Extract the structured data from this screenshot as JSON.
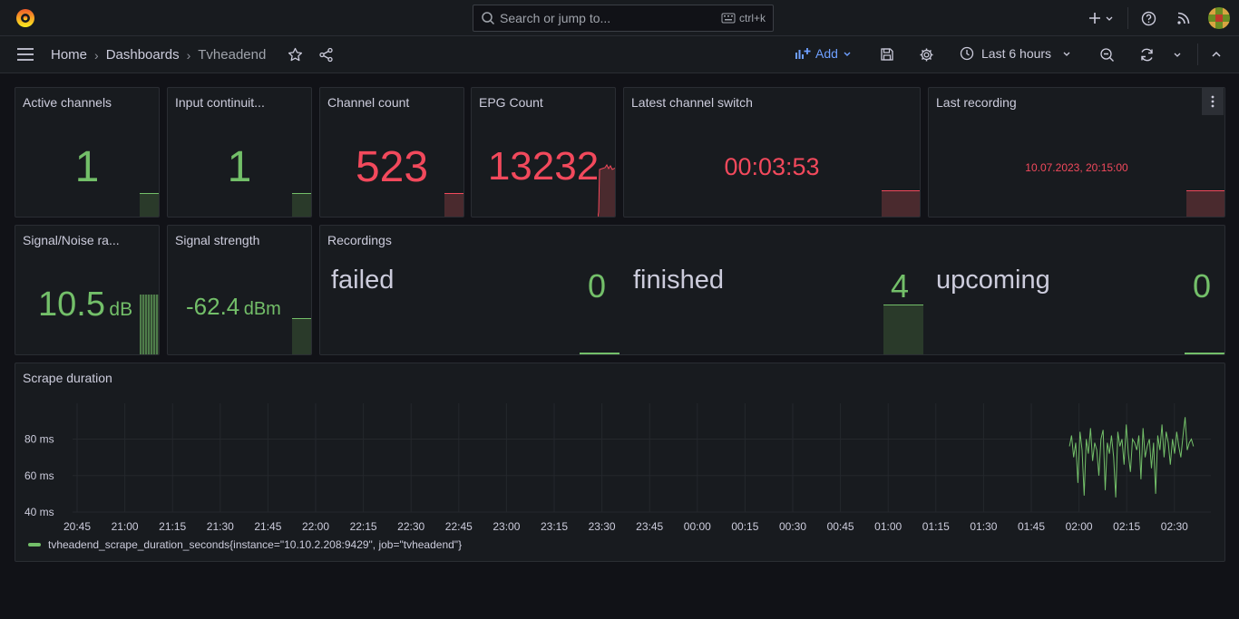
{
  "search": {
    "placeholder": "Search or jump to...",
    "shortcut": "ctrl+k"
  },
  "breadcrumb": {
    "home": "Home",
    "dashboards": "Dashboards",
    "current": "Tvheadend"
  },
  "toolbar": {
    "add_label": "Add",
    "time_range": "Last 6 hours"
  },
  "panels": {
    "active_channels": {
      "title": "Active channels",
      "value": "1"
    },
    "input_continuity": {
      "title": "Input continuit...",
      "value": "1"
    },
    "channel_count": {
      "title": "Channel count",
      "value": "523"
    },
    "epg_count": {
      "title": "EPG Count",
      "value": "13232"
    },
    "latest_switch": {
      "title": "Latest channel switch",
      "value": "00:03:53"
    },
    "last_recording": {
      "title": "Last recording",
      "value": "10.07.2023, 20:15:00"
    },
    "snr": {
      "title": "Signal/Noise ra...",
      "value": "10.5",
      "unit": "dB"
    },
    "signal_strength": {
      "title": "Signal strength",
      "value": "-62.4",
      "unit": "dBm"
    },
    "recordings": {
      "title": "Recordings",
      "items": [
        {
          "label": "failed",
          "value": "0"
        },
        {
          "label": "finished",
          "value": "4"
        },
        {
          "label": "upcoming",
          "value": "0"
        }
      ]
    },
    "scrape": {
      "title": "Scrape duration"
    }
  },
  "colors": {
    "green": "#73bf69",
    "red": "#f2495c",
    "bg": "#111217",
    "panel": "#181b1f"
  },
  "chart_data": {
    "type": "line",
    "title": "Scrape duration",
    "xlabel": "",
    "ylabel": "",
    "x_ticks": [
      "20:45",
      "21:00",
      "21:15",
      "21:30",
      "21:45",
      "22:00",
      "22:15",
      "22:30",
      "22:45",
      "23:00",
      "23:15",
      "23:30",
      "23:45",
      "00:00",
      "00:15",
      "00:30",
      "00:45",
      "01:00",
      "01:15",
      "01:30",
      "01:45",
      "02:00",
      "02:15",
      "02:30"
    ],
    "y_ticks": [
      "40 ms",
      "60 ms",
      "80 ms"
    ],
    "ylim": [
      40,
      95
    ],
    "grid": true,
    "legend_position": "bottom-left",
    "series": [
      {
        "name": "tvheadend_scrape_duration_seconds{instance=\"10.10.2.208:9429\", job=\"tvheadend\"}",
        "x_start": "01:57",
        "x_end": "02:36",
        "values": [
          76,
          82,
          70,
          78,
          56,
          84,
          74,
          49,
          80,
          72,
          86,
          68,
          78,
          74,
          60,
          80,
          85,
          52,
          78,
          72,
          82,
          70,
          48,
          84,
          76,
          80,
          66,
          88,
          72,
          62,
          80,
          78,
          74,
          82,
          58,
          86,
          70,
          76,
          80,
          64,
          78,
          50,
          82,
          74,
          88,
          70,
          84,
          78,
          66,
          80,
          72,
          84,
          76,
          70,
          82,
          92,
          74,
          78,
          80,
          76
        ]
      }
    ]
  }
}
